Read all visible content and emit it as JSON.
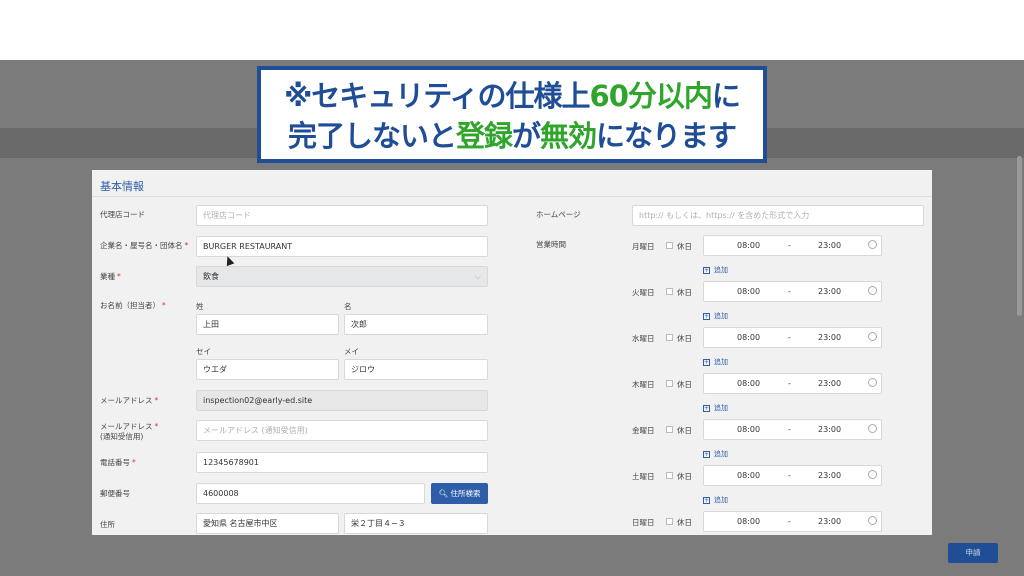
{
  "banner": {
    "l1_a": "※セキュリティの仕様上",
    "l1_b": "60分以内",
    "l1_c": "に",
    "l2_a": "完了しないと",
    "l2_b": "登録",
    "l2_c": "が",
    "l2_d": "無効",
    "l2_e": "になります"
  },
  "section_title": "基本情報",
  "left": {
    "agency_label": "代理店コード",
    "agency_placeholder": "代理店コード",
    "company_label": "企業名・屋号名・団体名",
    "company_value": "BURGER RESTAURANT",
    "industry_label": "業種",
    "industry_value": "飲食",
    "name_label": "お名前（担当者）",
    "last_name_label": "姓",
    "first_name_label": "名",
    "last_name_value": "上田",
    "first_name_value": "次郎",
    "last_kana_label": "セイ",
    "first_kana_label": "メイ",
    "last_kana_value": "ウエダ",
    "first_kana_value": "ジロウ",
    "email_label": "メールアドレス",
    "email_value": "inspection02@early-ed.site",
    "email2_label_1": "メールアドレス",
    "email2_label_2": "(通知受信用)",
    "email2_placeholder": "メールアドレス (通知受信用)",
    "phone_label": "電話番号",
    "phone_value": "12345678901",
    "postal_label": "郵便番号",
    "postal_value": "4600008",
    "address_search_button": "住所検索",
    "address_label": "住所",
    "address_value_1": "愛知県 名古屋市中区",
    "address_value_2": "栄２丁目４−３"
  },
  "right": {
    "homepage_label": "ホームページ",
    "homepage_placeholder": "http:// もしくは、https:// を含めた形式で入力",
    "hours_label": "営業時間",
    "holiday_label": "休日",
    "add_label": "追加",
    "dash": "-",
    "days": [
      {
        "name": "月曜日",
        "open": "08:00",
        "close": "23:00"
      },
      {
        "name": "火曜日",
        "open": "08:00",
        "close": "23:00"
      },
      {
        "name": "水曜日",
        "open": "08:00",
        "close": "23:00"
      },
      {
        "name": "木曜日",
        "open": "08:00",
        "close": "23:00"
      },
      {
        "name": "金曜日",
        "open": "08:00",
        "close": "23:00"
      },
      {
        "name": "土曜日",
        "open": "08:00",
        "close": "23:00"
      },
      {
        "name": "日曜日",
        "open": "08:00",
        "close": "23:00"
      }
    ]
  },
  "submit_button": "申請",
  "required_mark": "*",
  "icons": {
    "search": "search-icon",
    "clock": "clock-icon",
    "add": "plus-square-icon",
    "chevron": "chevron-down-icon"
  }
}
